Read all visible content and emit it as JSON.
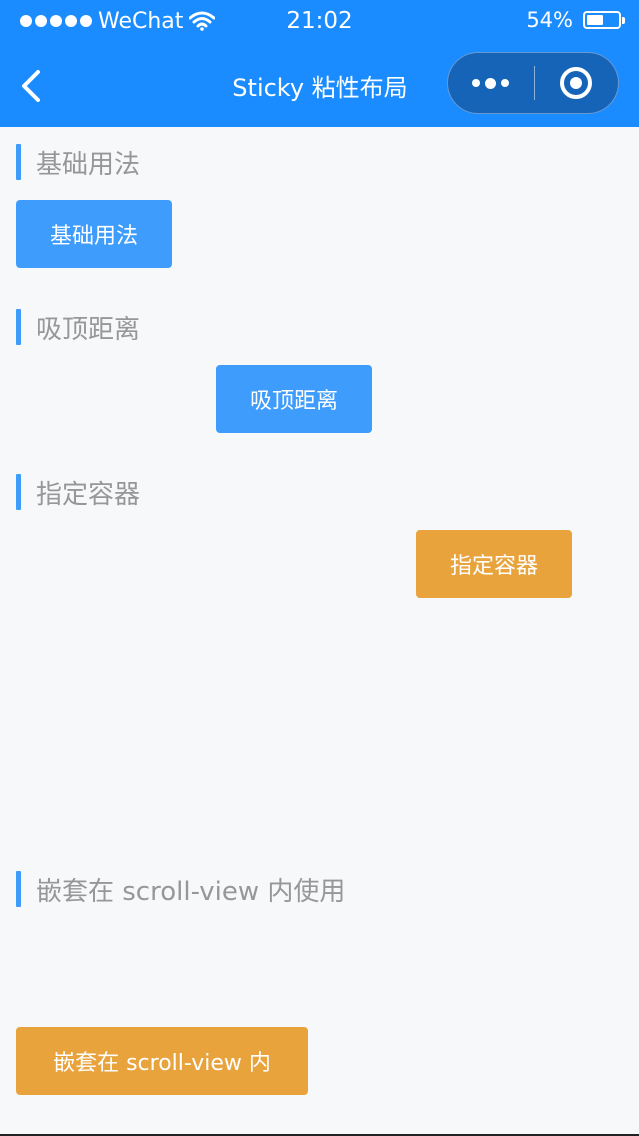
{
  "status_bar": {
    "carrier": "WeChat",
    "time": "21:02",
    "battery_text": "54%",
    "battery_level": 0.54
  },
  "nav": {
    "title": "Sticky 粘性布局",
    "back_icon": "chevron-left-icon",
    "more_icon": "more-dots-icon",
    "close_icon": "target-circle-icon"
  },
  "colors": {
    "brand": "#1a8cff",
    "primary_button": "#3e9cfc",
    "warning_button": "#e8a33c",
    "section_text": "#969799",
    "background": "#f7f8fa"
  },
  "sections": [
    {
      "title": "基础用法",
      "button_label": "基础用法"
    },
    {
      "title": "吸顶距离",
      "button_label": "吸顶距离"
    },
    {
      "title": "指定容器",
      "button_label": "指定容器"
    },
    {
      "title": "嵌套在 scroll-view 内使用",
      "button_label": "嵌套在 scroll-view 内"
    }
  ]
}
